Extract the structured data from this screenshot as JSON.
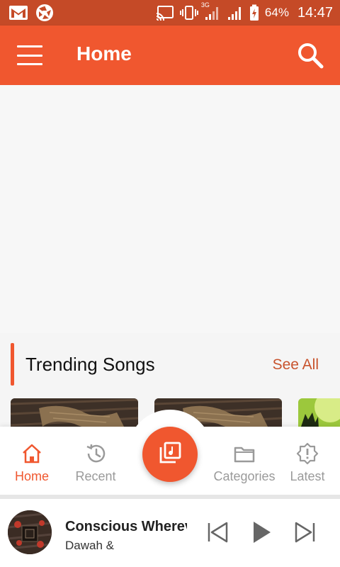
{
  "status_bar": {
    "network_label": "3G",
    "battery": "64%",
    "time": "14:47",
    "icons": [
      "gmail-icon",
      "aperture-icon",
      "cast-icon",
      "vibrate-icon",
      "signal-icon",
      "signal-icon",
      "battery-charging-icon"
    ]
  },
  "app_bar": {
    "title": "Home",
    "menu_icon": "hamburger-menu-icon",
    "search_icon": "search-icon"
  },
  "section": {
    "title": "Trending Songs",
    "see_all_label": "See All"
  },
  "song_cards": [
    {
      "thumbnail": "burlap-on-wood"
    },
    {
      "thumbnail": "burlap-on-wood"
    },
    {
      "thumbnail": "green-palm"
    }
  ],
  "bottom_nav": {
    "items": [
      {
        "label": "Home",
        "icon": "home-icon",
        "active": true
      },
      {
        "label": "Recent",
        "icon": "history-icon",
        "active": false
      },
      {
        "label": "Categories",
        "icon": "folder-icon",
        "active": false
      },
      {
        "label": "Latest",
        "icon": "alert-badge-icon",
        "active": false
      }
    ],
    "fab_icon": "music-library-icon"
  },
  "mini_player": {
    "title": "Conscious Wherev",
    "artist": "Dawah &",
    "controls": [
      "skip-previous-icon",
      "play-icon",
      "skip-next-icon"
    ]
  },
  "colors": {
    "accent": "#f0572f",
    "status_bar": "#c54a27",
    "see_all": "#c8532d",
    "inactive": "#9a9a9a"
  }
}
